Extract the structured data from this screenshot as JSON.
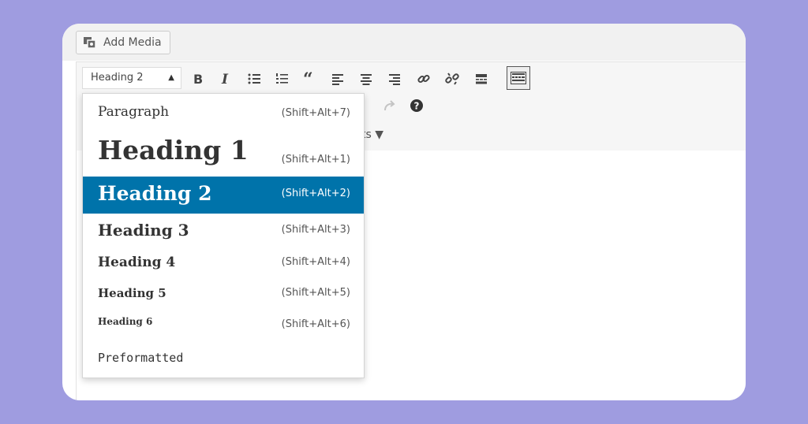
{
  "toolbar": {
    "add_media_label": "Add Media",
    "format_select_value": "Heading 2",
    "row3_partial_text": "ts ▼"
  },
  "icons": [
    "add-media-icon",
    "bold-icon",
    "italic-icon",
    "bulleted-list-icon",
    "numbered-list-icon",
    "blockquote-icon",
    "align-left-icon",
    "align-center-icon",
    "align-right-icon",
    "link-icon",
    "unlink-icon",
    "read-more-icon",
    "toolbar-toggle-icon",
    "redo-icon",
    "help-icon"
  ],
  "format_menu": {
    "items": [
      {
        "label": "Paragraph",
        "shortcut": "(Shift+Alt+7)"
      },
      {
        "label": "Heading 1",
        "shortcut": "(Shift+Alt+1)"
      },
      {
        "label": "Heading 2",
        "shortcut": "(Shift+Alt+2)",
        "selected": true
      },
      {
        "label": "Heading 3",
        "shortcut": "(Shift+Alt+3)"
      },
      {
        "label": "Heading 4",
        "shortcut": "(Shift+Alt+4)"
      },
      {
        "label": "Heading 5",
        "shortcut": "(Shift+Alt+5)"
      },
      {
        "label": "Heading 6",
        "shortcut": "(Shift+Alt+6)"
      },
      {
        "label": "Preformatted",
        "shortcut": ""
      }
    ]
  },
  "colors": {
    "background": "#9f9ce0",
    "selected_item": "#0073aa"
  }
}
